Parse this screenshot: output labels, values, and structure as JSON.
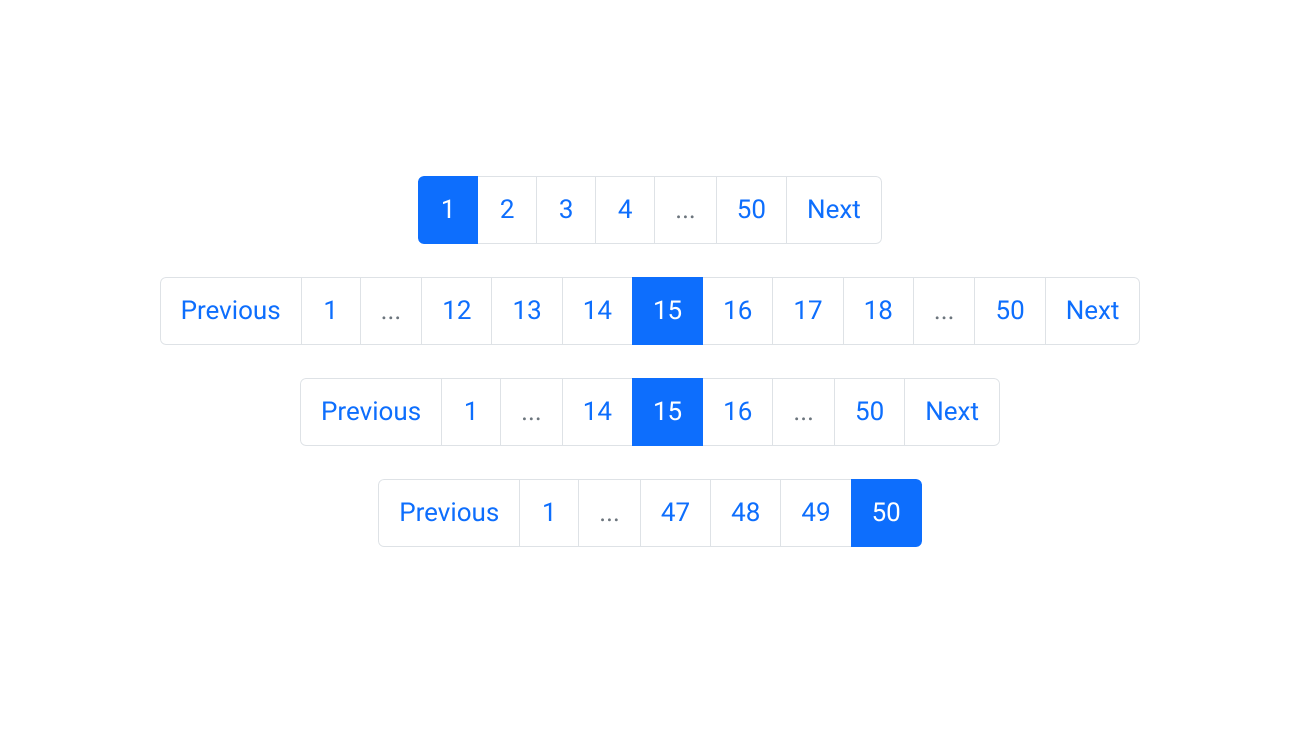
{
  "labels": {
    "previous": "Previous",
    "next": "Next",
    "ellipsis": "..."
  },
  "colors": {
    "primary": "#0d6efd",
    "border": "#dee2e6",
    "muted": "#6c757d"
  },
  "paginations": [
    {
      "id": "pagination-1",
      "items": [
        {
          "type": "page",
          "label": "1",
          "active": true
        },
        {
          "type": "page",
          "label": "2",
          "active": false
        },
        {
          "type": "page",
          "label": "3",
          "active": false
        },
        {
          "type": "page",
          "label": "4",
          "active": false
        },
        {
          "type": "ellipsis"
        },
        {
          "type": "page",
          "label": "50",
          "active": false
        },
        {
          "type": "next"
        }
      ]
    },
    {
      "id": "pagination-2",
      "items": [
        {
          "type": "previous"
        },
        {
          "type": "page",
          "label": "1",
          "active": false
        },
        {
          "type": "ellipsis"
        },
        {
          "type": "page",
          "label": "12",
          "active": false
        },
        {
          "type": "page",
          "label": "13",
          "active": false
        },
        {
          "type": "page",
          "label": "14",
          "active": false
        },
        {
          "type": "page",
          "label": "15",
          "active": true
        },
        {
          "type": "page",
          "label": "16",
          "active": false
        },
        {
          "type": "page",
          "label": "17",
          "active": false
        },
        {
          "type": "page",
          "label": "18",
          "active": false
        },
        {
          "type": "ellipsis"
        },
        {
          "type": "page",
          "label": "50",
          "active": false
        },
        {
          "type": "next"
        }
      ]
    },
    {
      "id": "pagination-3",
      "items": [
        {
          "type": "previous"
        },
        {
          "type": "page",
          "label": "1",
          "active": false
        },
        {
          "type": "ellipsis"
        },
        {
          "type": "page",
          "label": "14",
          "active": false
        },
        {
          "type": "page",
          "label": "15",
          "active": true
        },
        {
          "type": "page",
          "label": "16",
          "active": false
        },
        {
          "type": "ellipsis"
        },
        {
          "type": "page",
          "label": "50",
          "active": false
        },
        {
          "type": "next"
        }
      ]
    },
    {
      "id": "pagination-4",
      "items": [
        {
          "type": "previous"
        },
        {
          "type": "page",
          "label": "1",
          "active": false
        },
        {
          "type": "ellipsis"
        },
        {
          "type": "page",
          "label": "47",
          "active": false
        },
        {
          "type": "page",
          "label": "48",
          "active": false
        },
        {
          "type": "page",
          "label": "49",
          "active": false
        },
        {
          "type": "page",
          "label": "50",
          "active": true
        }
      ]
    }
  ]
}
